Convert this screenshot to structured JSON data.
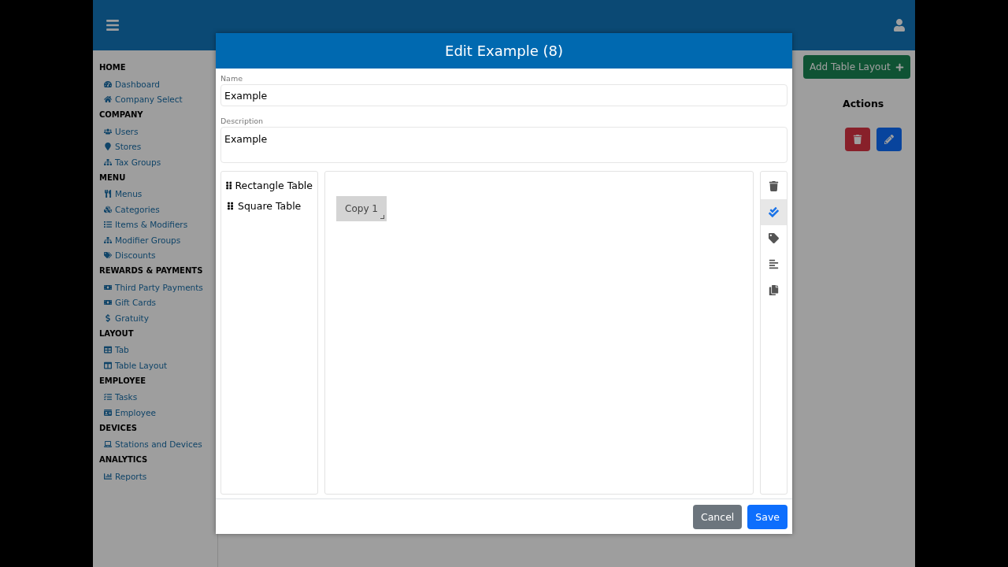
{
  "sidebar": {
    "sections": [
      {
        "heading": "HOME",
        "items": [
          "Dashboard",
          "Company Select"
        ]
      },
      {
        "heading": "COMPANY",
        "items": [
          "Users",
          "Stores",
          "Tax Groups"
        ]
      },
      {
        "heading": "MENU",
        "items": [
          "Menus",
          "Categories",
          "Items & Modifiers",
          "Modifier Groups",
          "Discounts"
        ]
      },
      {
        "heading": "REWARDS & PAYMENTS",
        "items": [
          "Third Party Payments",
          "Gift Cards",
          "Gratuity"
        ]
      },
      {
        "heading": "LAYOUT",
        "items": [
          "Tab",
          "Table Layout"
        ]
      },
      {
        "heading": "EMPLOYEE",
        "items": [
          "Tasks",
          "Employee"
        ]
      },
      {
        "heading": "DEVICES",
        "items": [
          "Stations and Devices"
        ]
      },
      {
        "heading": "ANALYTICS",
        "items": [
          "Reports"
        ]
      }
    ]
  },
  "main": {
    "add_button": "Add Table Layout",
    "actions_heading": "Actions"
  },
  "modal": {
    "title": "Edit Example (8)",
    "fields": [
      {
        "label": "Name",
        "value": "Example",
        "kind": "input"
      },
      {
        "label": "Description",
        "value": "Example",
        "kind": "textarea"
      }
    ],
    "palette": [
      "Rectangle Table",
      "Square Table"
    ],
    "canvas_items": [
      {
        "label": "Copy 1"
      }
    ],
    "tools": [
      {
        "kind": "delete",
        "selected": false
      },
      {
        "kind": "select",
        "selected": true
      },
      {
        "kind": "tag",
        "selected": false
      },
      {
        "kind": "align",
        "selected": false
      },
      {
        "kind": "copy",
        "selected": false
      }
    ],
    "buttons": [
      {
        "label": "Cancel",
        "kind": "secondary"
      },
      {
        "label": "Save",
        "kind": "primary"
      }
    ]
  }
}
